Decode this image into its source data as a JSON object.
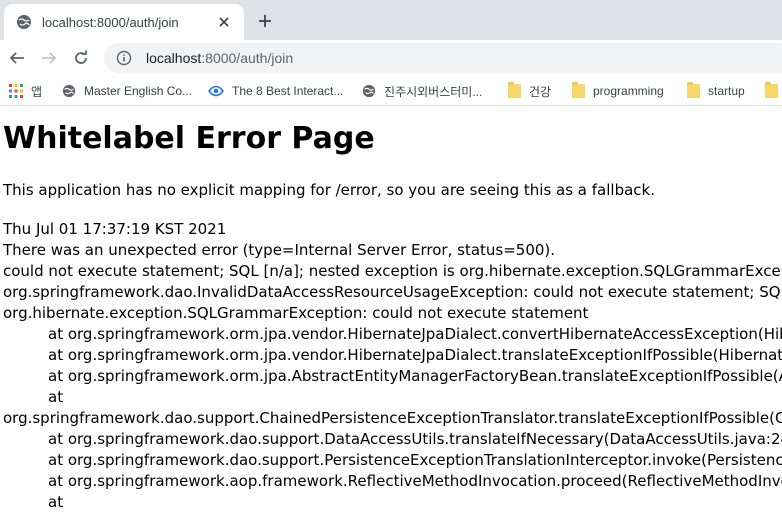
{
  "browser": {
    "tab": {
      "title": "localhost:8000/auth/join"
    },
    "omnibox": {
      "host": "localhost",
      "path": ":8000/auth/join"
    },
    "bookmarks": [
      {
        "label": "앱",
        "icon": "apps-grid-icon"
      },
      {
        "label": "Master English Co...",
        "icon": "globe-icon"
      },
      {
        "label": "The 8 Best Interact...",
        "icon": "link-icon"
      },
      {
        "label": "진주시외버스터미...",
        "icon": "globe-icon"
      },
      {
        "label": "건강",
        "icon": "folder-icon"
      },
      {
        "label": "programming",
        "icon": "folder-icon"
      },
      {
        "label": "startup",
        "icon": "folder-icon"
      }
    ]
  },
  "page": {
    "title": "Whitelabel Error Page",
    "message": "This application has no explicit mapping for /error, so you are seeing this as a fallback.",
    "lines": [
      "Thu Jul 01 17:37:19 KST 2021",
      "There was an unexpected error (type=Internal Server Error, status=500).",
      "could not execute statement; SQL [n/a]; nested exception is org.hibernate.exception.SQLGrammarException: could not execute statement",
      "org.springframework.dao.InvalidDataAccessResourceUsageException: could not execute statement; SQL [n/a]; nested exception is org.hibernate.exception.SQLGrammarException: could not execute statement",
      "org.hibernate.exception.SQLGrammarException: could not execute statement"
    ],
    "stack": [
      "at org.springframework.orm.jpa.vendor.HibernateJpaDialect.convertHibernateAccessException(HibernateJpaDialect.java:259)",
      "at org.springframework.orm.jpa.vendor.HibernateJpaDialect.translateExceptionIfPossible(HibernateJpaDialect.java:233)",
      "at org.springframework.orm.jpa.AbstractEntityManagerFactoryBean.translateExceptionIfPossible(AbstractEntityManagerFactoryBean.java:551)",
      "at",
      "org.springframework.dao.support.ChainedPersistenceExceptionTranslator.translateExceptionIfPossible(ChainedPersistenceExceptionTranslator.java:61)",
      "at org.springframework.dao.support.DataAccessUtils.translateIfNecessary(DataAccessUtils.java:242)",
      "at org.springframework.dao.support.PersistenceExceptionTranslationInterceptor.invoke(PersistenceExceptionTranslationInterceptor.java:152)",
      "at org.springframework.aop.framework.ReflectiveMethodInvocation.proceed(ReflectiveMethodInvocation.java:186)",
      "at"
    ]
  }
}
